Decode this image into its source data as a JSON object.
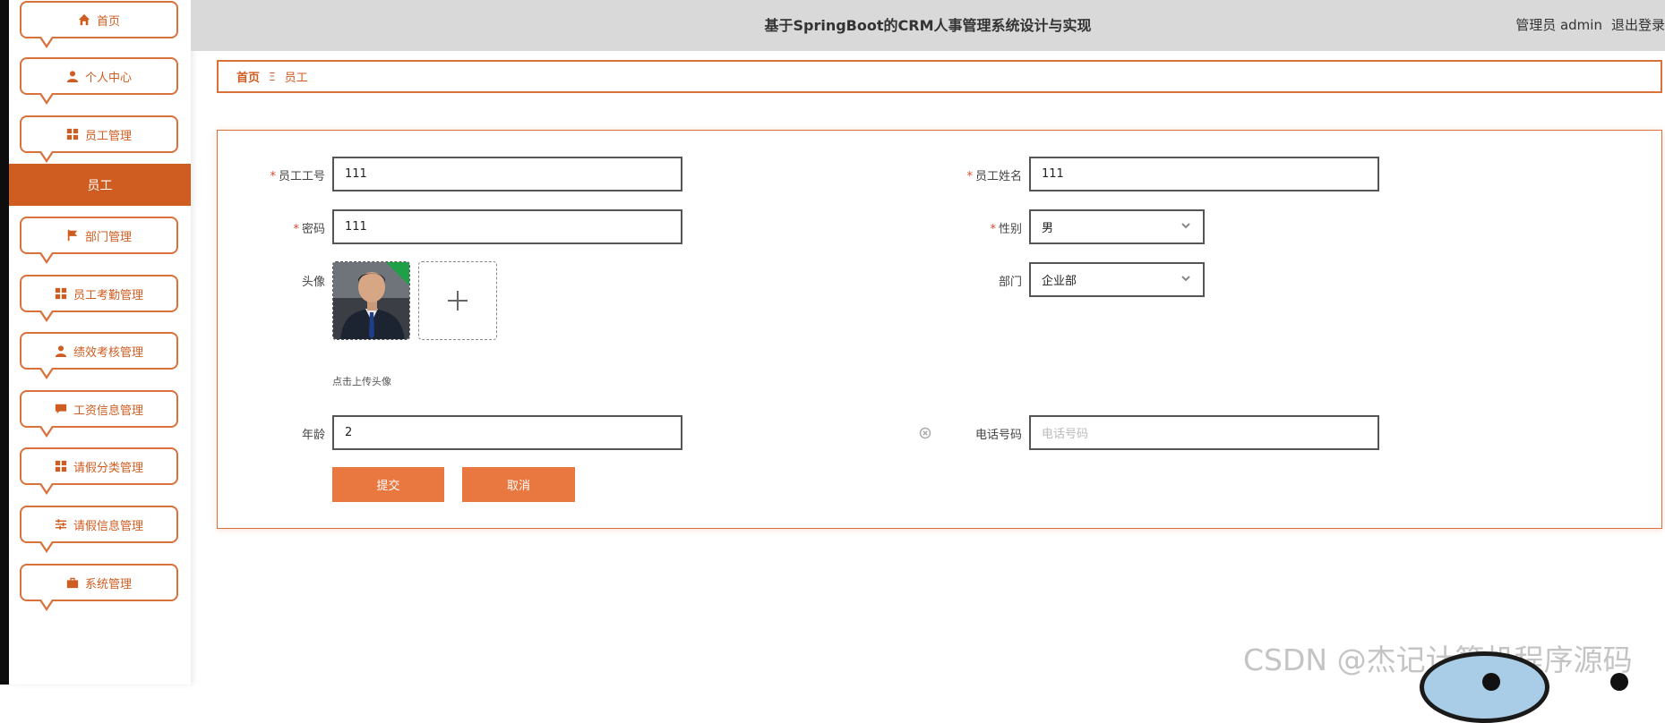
{
  "app": {
    "title": "基于SpringBoot的CRM人事管理系统设计与实现",
    "user": "管理员 admin",
    "logout": "退出登录"
  },
  "sidebar": {
    "items": [
      {
        "label": "首页",
        "icon": "home-icon"
      },
      {
        "label": "个人中心",
        "icon": "user-icon"
      },
      {
        "label": "员工管理",
        "icon": "grid-icon"
      },
      {
        "label": "部门管理",
        "icon": "flag-icon"
      },
      {
        "label": "员工考勤管理",
        "icon": "grid-icon"
      },
      {
        "label": "绩效考核管理",
        "icon": "user-icon"
      },
      {
        "label": "工资信息管理",
        "icon": "chat-icon"
      },
      {
        "label": "请假分类管理",
        "icon": "grid-icon"
      },
      {
        "label": "请假信息管理",
        "icon": "sliders-icon"
      },
      {
        "label": "系统管理",
        "icon": "briefcase-icon"
      }
    ],
    "active_sub": "员工"
  },
  "breadcrumb": {
    "home": "首页",
    "separator": "Ξ",
    "current": "员工"
  },
  "form": {
    "emp_no": {
      "label": "员工工号",
      "value": "111"
    },
    "emp_name": {
      "label": "员工姓名",
      "value": "111"
    },
    "password": {
      "label": "密码",
      "value": "111"
    },
    "gender": {
      "label": "性别",
      "value": "男"
    },
    "avatar": {
      "label": "头像",
      "hint": "点击上传头像"
    },
    "department": {
      "label": "部门",
      "value": "企业部"
    },
    "age": {
      "label": "年龄",
      "value": "2"
    },
    "phone": {
      "label": "电话号码",
      "placeholder": "电话号码"
    },
    "submit": "提交",
    "cancel": "取消"
  },
  "watermark": "CSDN @杰记计算机程序源码",
  "colors": {
    "accent": "#cf5d22",
    "button": "#e87840",
    "topbar": "#d9d9d9"
  }
}
